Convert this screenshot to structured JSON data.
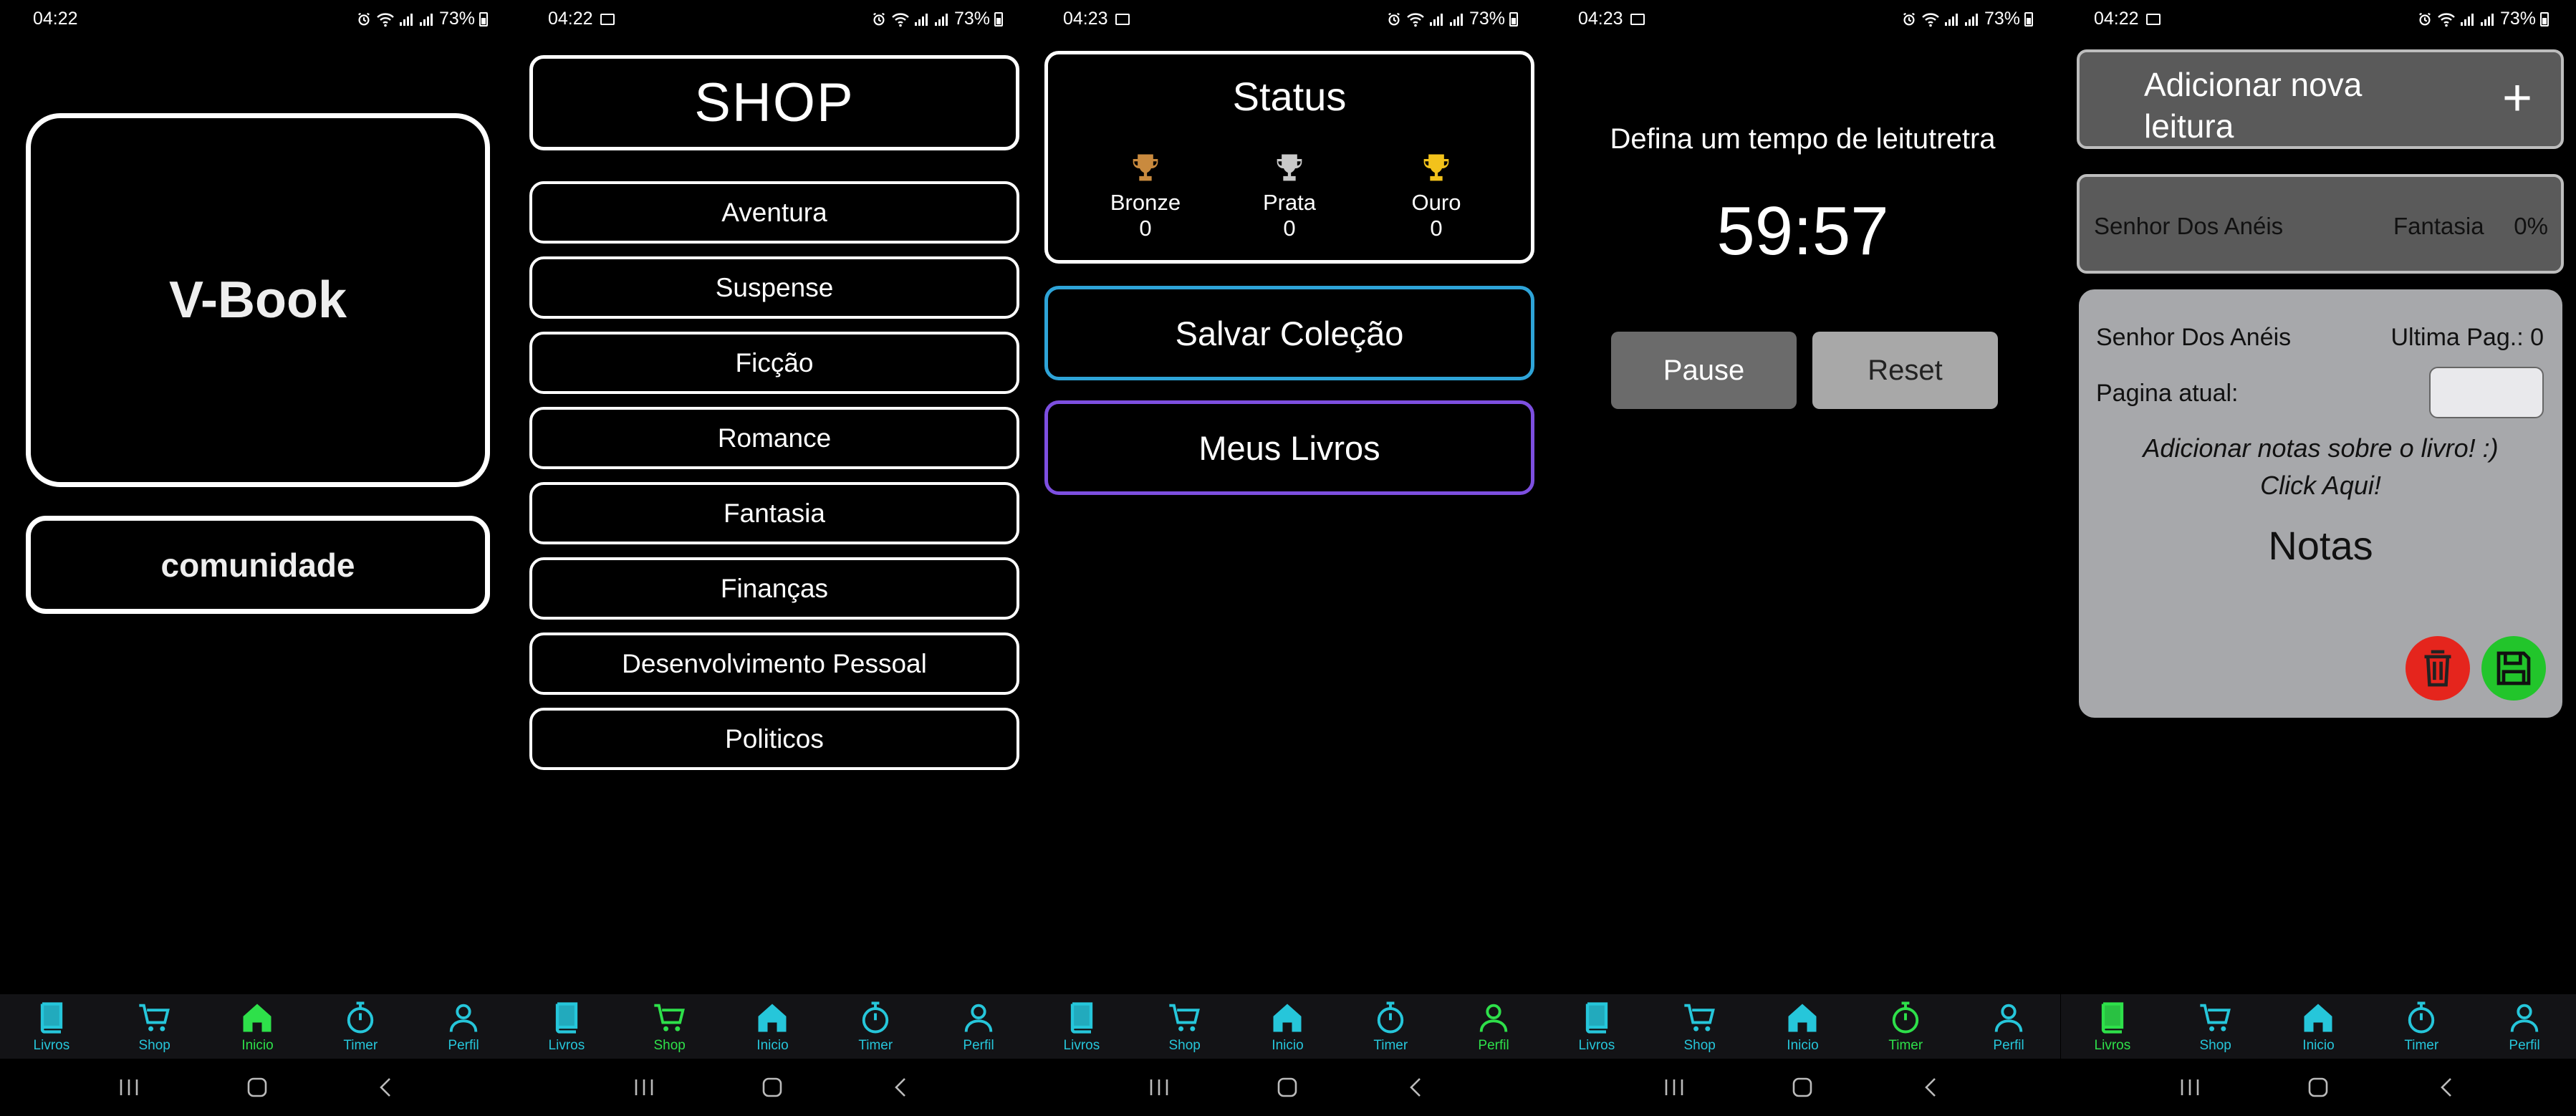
{
  "colors": {
    "nav_active": "#2ee04a",
    "nav_inactive": "#26c6da",
    "trophy_bronze": "#c98a3e",
    "trophy_silver": "#c9c9c9",
    "trophy_gold": "#f2c21b",
    "salvar_border": "#2ea4d8",
    "meus_border": "#7d4fe0"
  },
  "screens": [
    {
      "status": {
        "time": "04:22",
        "battery": "73%",
        "show_image_icon": false
      },
      "content": {
        "logo_text": "V-Book",
        "community_label": "comunidade"
      },
      "active_tab": "inicio"
    },
    {
      "status": {
        "time": "04:22",
        "battery": "73%",
        "show_image_icon": true
      },
      "content": {
        "title": "SHOP",
        "categories": [
          "Aventura",
          "Suspense",
          "Ficção",
          "Romance",
          "Fantasia",
          "Finanças",
          "Desenvolvimento Pessoal",
          "Politicos"
        ]
      },
      "active_tab": "shop"
    },
    {
      "status": {
        "time": "04:23",
        "battery": "73%",
        "show_image_icon": true
      },
      "content": {
        "title": "Status",
        "trophies": [
          {
            "name": "Bronze",
            "count": "0",
            "icon": "trophy-icon"
          },
          {
            "name": "Prata",
            "count": "0",
            "icon": "trophy-icon"
          },
          {
            "name": "Ouro",
            "count": "0",
            "icon": "trophy-icon"
          }
        ],
        "salvar_label": "Salvar Coleção",
        "meus_label": "Meus Livros"
      },
      "active_tab": "perfil"
    },
    {
      "status": {
        "time": "04:23",
        "battery": "73%",
        "show_image_icon": true
      },
      "content": {
        "label": "Defina um tempo de leitutretra",
        "time": "59:57",
        "pause_label": "Pause",
        "reset_label": "Reset"
      },
      "active_tab": "timer"
    },
    {
      "status": {
        "time": "04:22",
        "battery": "73%",
        "show_image_icon": true
      },
      "content": {
        "add_label": "Adicionar nova leitura",
        "add_icon": "+",
        "book": {
          "title": "Senhor Dos Anéis",
          "genre": "Fantasia",
          "progress": "0%"
        },
        "notes_card": {
          "title": "Senhor Dos Anéis",
          "ultima": "Ultima Pag.: 0",
          "pagina_label": "Pagina atual:",
          "pagina_value": "",
          "hint_line1": "Adicionar notas sobre o livro! :)",
          "hint_line2": "Click Aqui!",
          "notas": "Notas"
        }
      },
      "active_tab": "livros"
    }
  ],
  "nav_items": [
    {
      "key": "livros",
      "label": "Livros",
      "icon": "book-icon"
    },
    {
      "key": "shop",
      "label": "Shop",
      "icon": "cart-icon"
    },
    {
      "key": "inicio",
      "label": "Inicio",
      "icon": "home-icon"
    },
    {
      "key": "timer",
      "label": "Timer",
      "icon": "stopwatch-icon"
    },
    {
      "key": "perfil",
      "label": "Perfil",
      "icon": "person-icon"
    }
  ]
}
